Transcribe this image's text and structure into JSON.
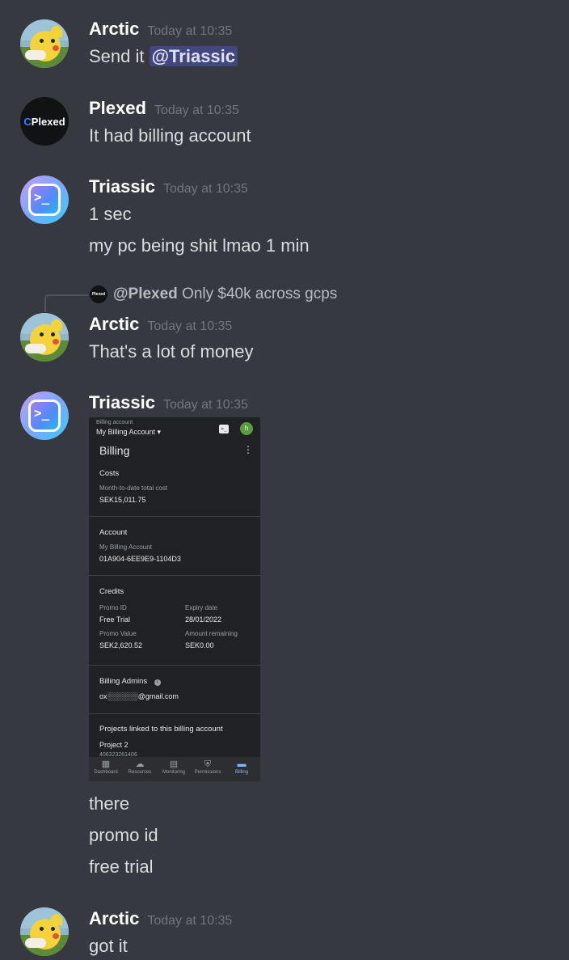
{
  "messages": [
    {
      "author": "Arctic",
      "time": "Today at 10:35",
      "lines": [
        "Send it "
      ],
      "mention": "@Triassic"
    },
    {
      "author": "Plexed",
      "time": "Today at 10:35",
      "lines": [
        "It had billing account"
      ]
    },
    {
      "author": "Triassic",
      "time": "Today at 10:35",
      "lines": [
        "1 sec",
        "my pc being shit lmao 1 min"
      ]
    },
    {
      "author": "Arctic",
      "time": "Today at 10:35",
      "lines": [
        "That's a lot of money"
      ]
    },
    {
      "author": "Triassic",
      "time": "Today at 10:35",
      "lines": [
        "there",
        "promo id",
        "free trial"
      ]
    },
    {
      "author": "Arctic",
      "time": "Today at 10:35",
      "lines": [
        "got it"
      ]
    }
  ],
  "reply": {
    "author": "@Plexed",
    "text": "Only $40k across gcps"
  },
  "plexed_logo": "Plexed",
  "plexed_logo_mini": "Plexed",
  "attachment": {
    "account_label": "Billing account",
    "account_name": "My Billing Account ▾",
    "avatar_letter": "h",
    "title": "Billing",
    "costs": {
      "heading": "Costs",
      "label": "Month-to-date total cost",
      "value": "SEK15,011.75"
    },
    "account": {
      "heading": "Account",
      "label": "My Billing Account",
      "value": "01A904-6EE9E9-1104D3"
    },
    "credits": {
      "heading": "Credits",
      "promo_id_label": "Promo ID",
      "promo_id": "Free Trial",
      "expiry_label": "Expiry date",
      "expiry": "28/01/2022",
      "promo_value_label": "Promo Value",
      "promo_value": "SEK2,620.52",
      "remaining_label": "Amount remaining",
      "remaining": "SEK0.00"
    },
    "admins": {
      "heading": "Billing Admins",
      "email": "ox░░░░░░@gmail.com"
    },
    "projects": {
      "heading": "Projects linked to this billing account",
      "project": "Project 2",
      "project_id": "406323261406"
    },
    "nav": [
      "Dashboard",
      "Resources",
      "Monitoring",
      "Permissions",
      "Billing"
    ]
  }
}
